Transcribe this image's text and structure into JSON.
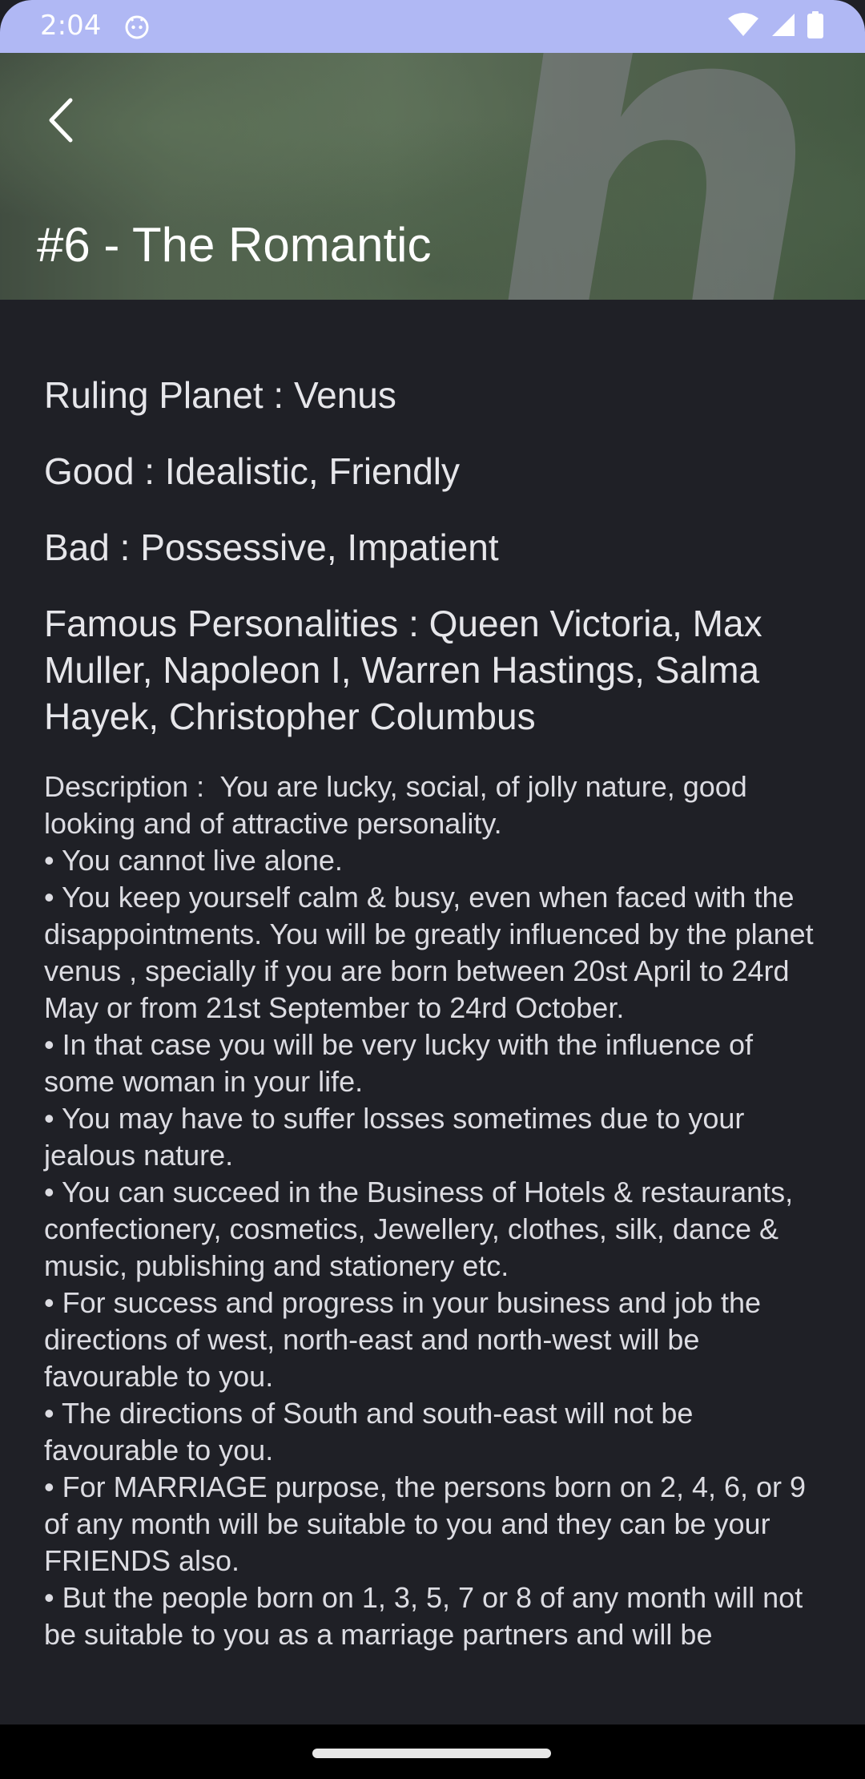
{
  "status_bar": {
    "time": "2:04",
    "app_icon": "android-debug-icon",
    "icons": [
      "wifi-icon",
      "cell-signal-icon",
      "battery-icon"
    ]
  },
  "header": {
    "back_icon": "chevron-left-icon",
    "title": "#6 - The Romantic"
  },
  "details": {
    "ruling_planet_label": "Ruling Planet :",
    "ruling_planet_value": "Venus",
    "good_label": "Good :",
    "good_value": "Idealistic, Friendly",
    "bad_label": "Bad :",
    "bad_value": "Possessive, Impatient",
    "famous_label": "Famous Personalities :",
    "famous_value": "Queen Victoria, Max Muller, Napoleon I, Warren Hastings, Salma Hayek, Christopher Columbus",
    "description_label": "Description :",
    "description_text": "You are lucky, social, of jolly nature, good looking and of attractive personality.\n• You cannot live alone.\n• You keep yourself calm & busy, even when faced with the disappointments. You will be greatly influenced by the planet venus , specially if you are born between 20st April to 24rd May or from 21st September to 24rd October.\n• In that case you will be very lucky with the influence of some woman in your life.\n• You may have to suffer losses sometimes due to your jealous nature.\n• You can succeed in the Business of Hotels & restaurants, confectionery, cosmetics, Jewellery, clothes, silk, dance & music, publishing and stationery etc.\n• For success and progress in your business and job the directions of west, north-east and north-west will be favourable to you.\n• The directions of South and south-east will not be favourable to you.\n• For MARRIAGE purpose, the persons born on 2, 4, 6, or 9 of any month will be suitable to you and they can be your FRIENDS also.\n• But the people born on 1, 3, 5, 7 or 8 of any month will not be suitable to you as a marriage partners and will be"
  },
  "colors": {
    "status_bar": "#b0b8f4",
    "background": "#1f2026",
    "text": "#e6e6ea"
  }
}
